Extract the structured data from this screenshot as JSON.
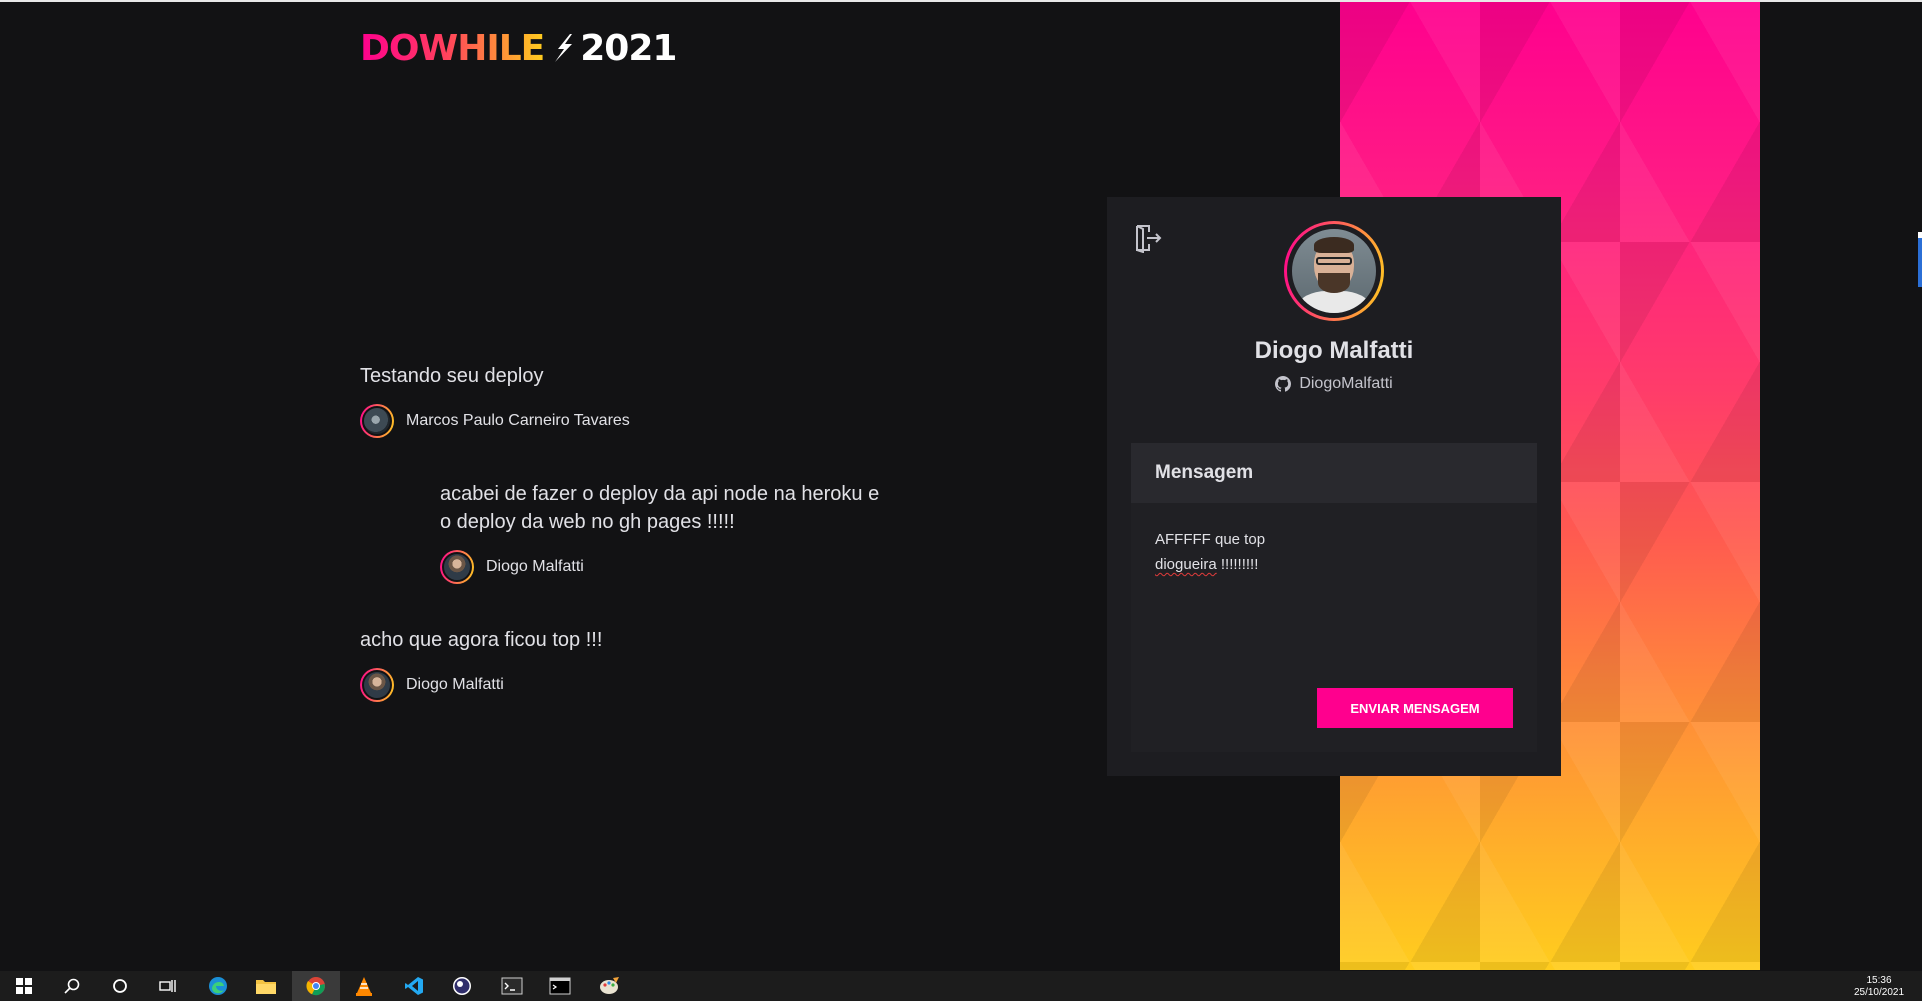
{
  "app": {
    "logo_prefix": "DOWHILE",
    "logo_year": "2021"
  },
  "messages": [
    {
      "text": "Testando seu deploy",
      "user": "Marcos Paulo Carneiro Tavares"
    },
    {
      "text": "acabei de fazer o deploy da api node na heroku e o deploy da web no gh pages !!!!!",
      "user": "Diogo Malfatti"
    },
    {
      "text": "acho que agora ficou top !!!",
      "user": "Diogo Malfatti"
    }
  ],
  "profile": {
    "name": "Diogo Malfatti",
    "github_user": "DiogoMalfatti",
    "signout_icon": "sign-out-icon"
  },
  "form": {
    "title": "Mensagem",
    "text_line1": "AFFFFF que top",
    "text_word": "diogueira",
    "text_rest": " !!!!!!!!!",
    "send_label": "Enviar mensagem"
  },
  "taskbar": {
    "apps": [
      "windows-start-icon",
      "search-icon",
      "cortana-icon",
      "task-view-icon",
      "edge-icon",
      "file-explorer-icon",
      "chrome-icon",
      "vlc-icon",
      "vscode-icon",
      "obs-icon",
      "terminal-icon",
      "cmd-icon",
      "paint-icon"
    ],
    "time": "15:36",
    "date": "25/10/2021"
  },
  "colors": {
    "background": "#121214",
    "card": "#1d1d21",
    "accent": "#ff008e",
    "gradient_end": "#ffcd1e"
  }
}
